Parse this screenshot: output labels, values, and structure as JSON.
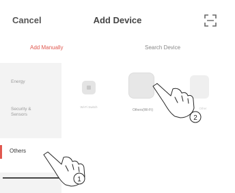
{
  "header": {
    "cancel_label": "Cancel",
    "title": "Add Device",
    "scan_icon": "scan-icon"
  },
  "tabs": [
    {
      "label": "Add Manually",
      "active": true
    },
    {
      "label": "Search Device",
      "active": false
    }
  ],
  "sidebar": {
    "items": [
      {
        "label": "Energy"
      },
      {
        "label": "Security & Sensors"
      },
      {
        "label": "Others",
        "selected": true
      }
    ]
  },
  "devices": [
    {
      "label": "Wi-Fi Switch"
    },
    {
      "label": "Others(Wi-Fi)"
    },
    {
      "label": "Other"
    }
  ],
  "annotations": [
    {
      "number": "1"
    },
    {
      "number": "2"
    }
  ],
  "colors": {
    "accent": "#e0584f",
    "sidebar_bg": "#f3f3f3"
  }
}
